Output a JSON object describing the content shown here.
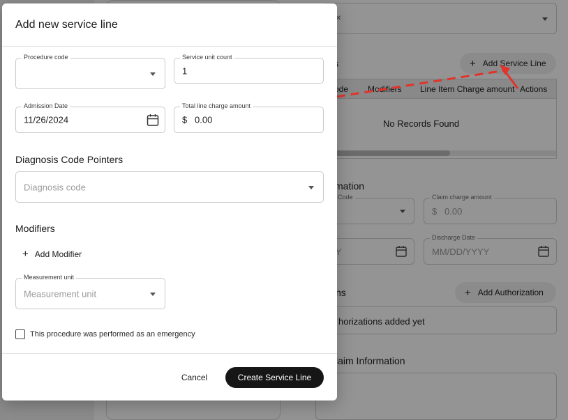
{
  "modal": {
    "title": "Add new service line",
    "procedure_code": {
      "label": "Procedure code",
      "value": ""
    },
    "service_unit_count": {
      "label": "Service unit count",
      "value": "1"
    },
    "admission_date": {
      "label": "Admission Date",
      "value": "11/26/2024"
    },
    "total_line_charge": {
      "label": "Total line charge amount",
      "currency": "$",
      "value": "0.00"
    },
    "diagnosis_section": {
      "heading": "Diagnosis Code Pointers",
      "placeholder": "Diagnosis code"
    },
    "modifiers_section": {
      "heading": "Modifiers",
      "add_label": "Add Modifier"
    },
    "measurement_unit": {
      "label": "Measurement unit",
      "placeholder": "Measurement unit"
    },
    "emergency_checkbox": {
      "label": "This procedure was performed as an emergency",
      "checked": false
    },
    "cancel_label": "Cancel",
    "create_label": "Create Service Line"
  },
  "background": {
    "service_lines": {
      "heading_fragment": "s",
      "add_label": "Add Service Line",
      "columns": [
        "ode",
        "Modifiers",
        "Line Item Charge amount",
        "Actions"
      ],
      "empty_text": "No Records Found"
    },
    "info_heading_fragment": "mation",
    "code_label": "Code",
    "claim_charge": {
      "label": "Claim charge amount",
      "currency": "$",
      "placeholder": "0.00"
    },
    "admission_fragment": "Y",
    "discharge_date": {
      "label": "Discharge Date",
      "placeholder": "MM/DD/YYYY"
    },
    "authorizations": {
      "heading_fragment": "ns",
      "add_label": "Add Authorization",
      "empty_text": "horizations added yet"
    },
    "claim_info_fragment": "laim Information"
  },
  "colors": {
    "primary_button": "#161616",
    "annotation_arrow": "#e0342b"
  }
}
